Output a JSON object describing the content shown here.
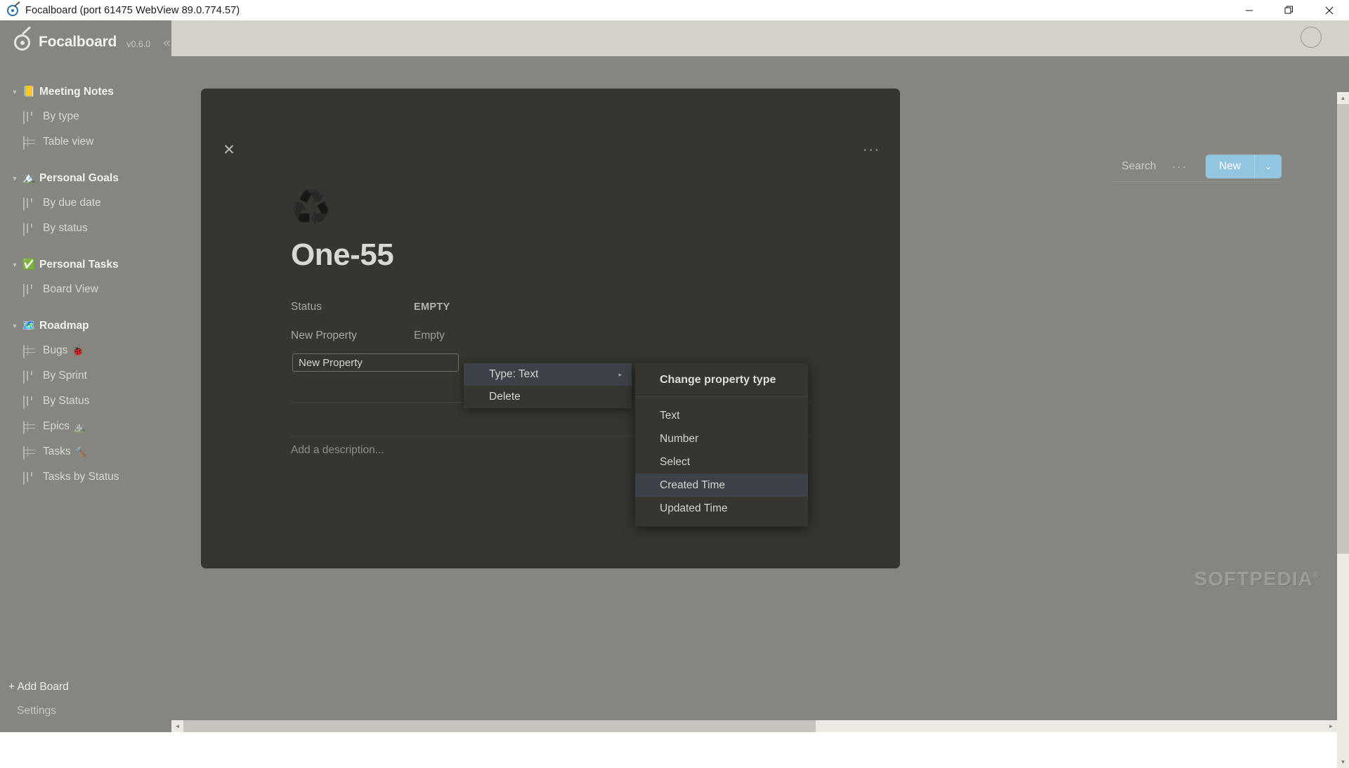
{
  "window": {
    "title": "Focalboard (port 61475 WebView 89.0.774.57)",
    "app_icon": "focalboard-target-icon",
    "minimize_label": "—",
    "maximize_label": "❐",
    "close_label": "✕"
  },
  "sidebar": {
    "brand": "Focalboard",
    "version": "v0.6.0",
    "collapse_label": "«",
    "boards": [
      {
        "emoji": "📒",
        "title": "Meeting Notes",
        "caret": "▼",
        "views": [
          {
            "label": "By type",
            "icon": "board-view-icon",
            "emoji": ""
          },
          {
            "label": "Table view",
            "icon": "table-view-icon",
            "emoji": ""
          }
        ]
      },
      {
        "emoji": "🏔️",
        "title": "Personal Goals",
        "caret": "▼",
        "views": [
          {
            "label": "By due date",
            "icon": "board-view-icon",
            "emoji": ""
          },
          {
            "label": "By status",
            "icon": "board-view-icon",
            "emoji": ""
          }
        ]
      },
      {
        "emoji": "✅",
        "title": "Personal Tasks",
        "caret": "▼",
        "views": [
          {
            "label": "Board View",
            "icon": "board-view-icon",
            "emoji": ""
          }
        ]
      },
      {
        "emoji": "🗺️",
        "title": "Roadmap",
        "caret": "▼",
        "views": [
          {
            "label": "Bugs",
            "icon": "table-view-icon",
            "emoji": "🐞"
          },
          {
            "label": "By Sprint",
            "icon": "board-view-icon",
            "emoji": ""
          },
          {
            "label": "By Status",
            "icon": "board-view-icon",
            "emoji": ""
          },
          {
            "label": "Epics",
            "icon": "table-view-icon",
            "emoji": "⛰️"
          },
          {
            "label": "Tasks",
            "icon": "table-view-icon",
            "emoji": "🔨"
          },
          {
            "label": "Tasks by Status",
            "icon": "board-view-icon",
            "emoji": ""
          }
        ]
      }
    ],
    "add_board": "+ Add Board",
    "settings": "Settings"
  },
  "toolbar": {
    "search_label": "Search",
    "more_label": "···",
    "new_label": "New",
    "new_caret": "⌄"
  },
  "card": {
    "close_label": "✕",
    "menu_label": "···",
    "icon": "♻️",
    "icon_name": "recycling-symbol-icon",
    "title": "One-55",
    "properties": [
      {
        "name": "Status",
        "value": "EMPTY",
        "style": "caps"
      },
      {
        "name": "New Property",
        "value": "Empty",
        "style": "normal"
      }
    ],
    "description_placeholder": "Add a description..."
  },
  "property_editor": {
    "name_value": "New Property",
    "name_placeholder": "New Property",
    "menu_items": [
      {
        "label": "Type: Text",
        "has_submenu": true,
        "highlighted": true,
        "arrow": "▸"
      },
      {
        "label": "Delete",
        "has_submenu": false,
        "highlighted": false,
        "arrow": ""
      }
    ]
  },
  "type_submenu": {
    "header": "Change property type",
    "options": [
      {
        "label": "Text",
        "highlighted": false
      },
      {
        "label": "Number",
        "highlighted": false
      },
      {
        "label": "Select",
        "highlighted": false
      },
      {
        "label": "Created Time",
        "highlighted": true
      },
      {
        "label": "Updated Time",
        "highlighted": false
      }
    ]
  },
  "watermark": {
    "text": "SOFTPEDIA",
    "mark": "®"
  },
  "scrollbars": {
    "up": "▲",
    "down": "▼",
    "left": "◄",
    "right": "►"
  },
  "colors": {
    "accent_blue": "#92c5e0",
    "sidebar_bg": "#86857f",
    "card_bg": "#36352f",
    "highlight": "#3c4247"
  }
}
